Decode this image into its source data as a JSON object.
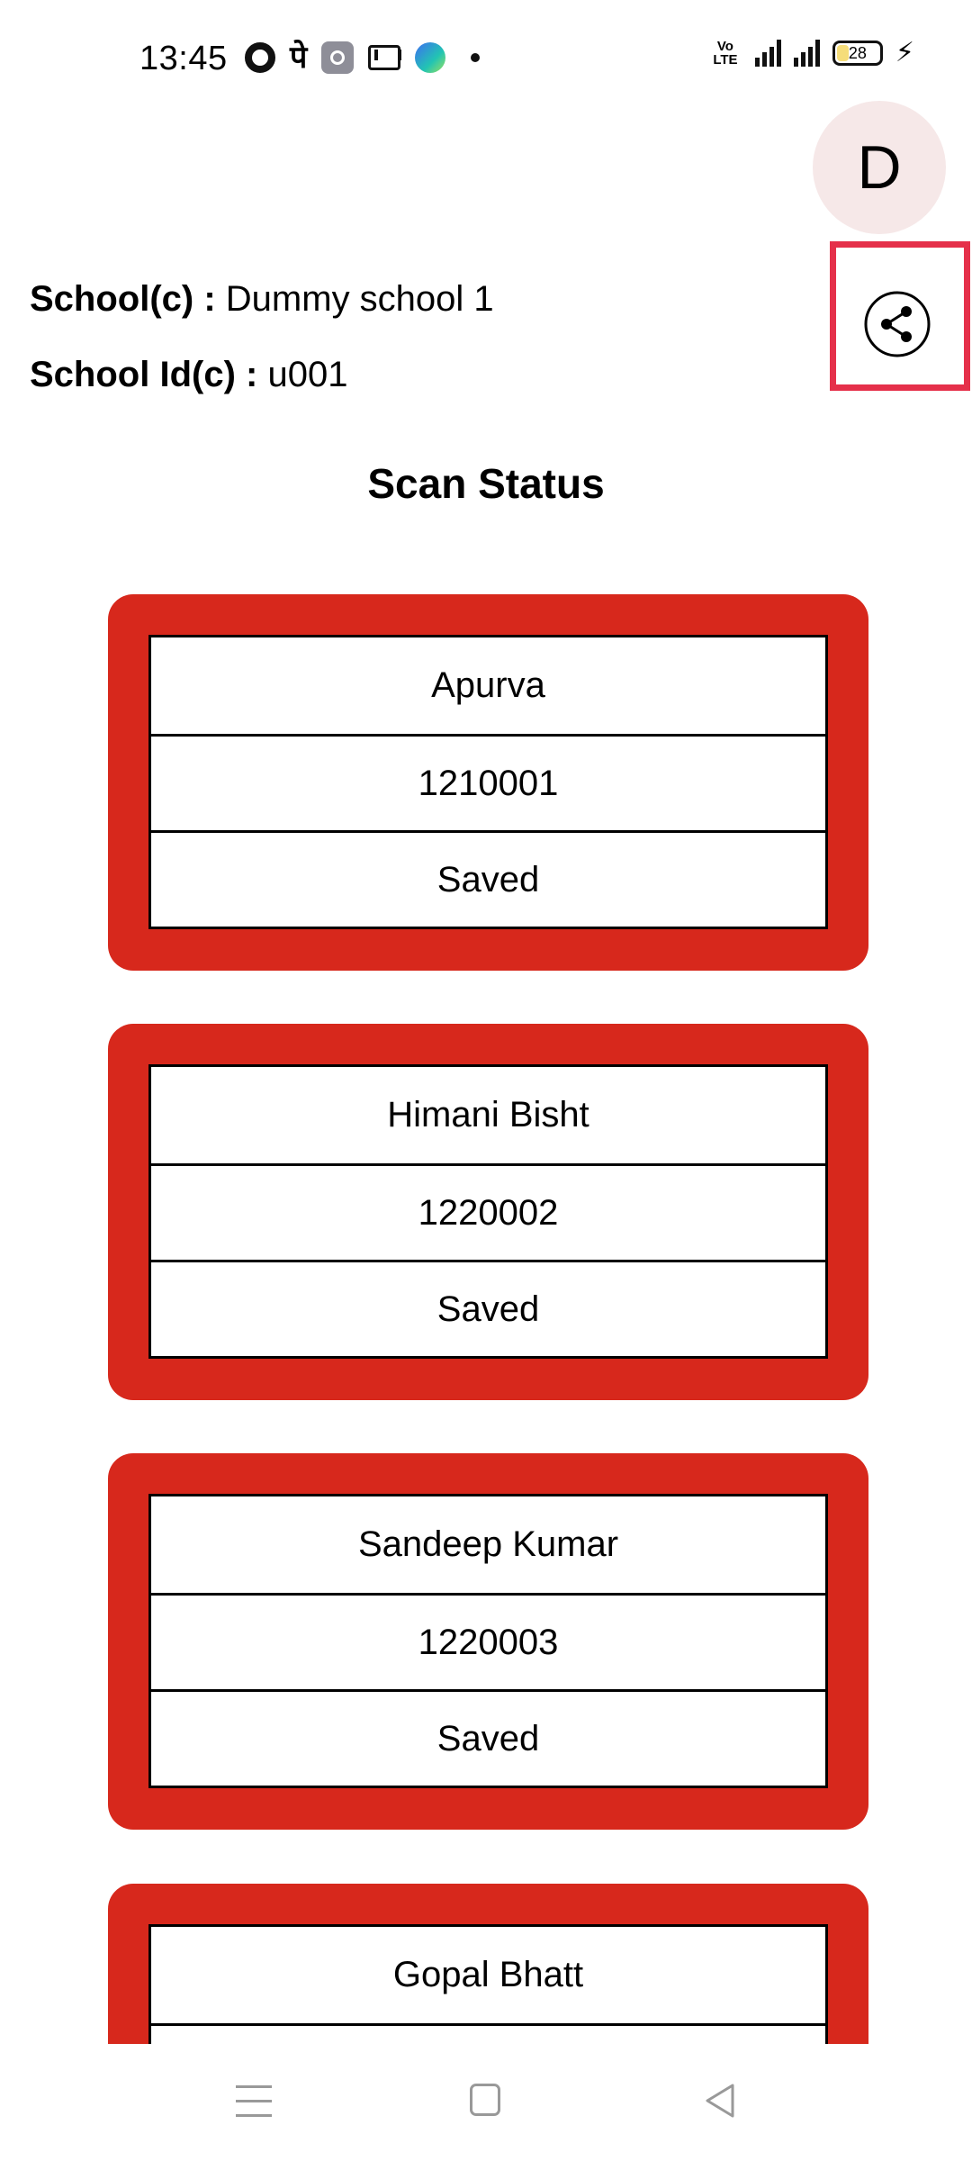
{
  "status_bar": {
    "time": "13:45",
    "left_icons": [
      "ring-icon",
      "phonepe-icon",
      "settings-app-icon",
      "mail-icon",
      "app-ball-icon",
      "notification-dot-icon"
    ],
    "volte": "VoLTE",
    "network": "4G",
    "battery": "28"
  },
  "avatar": {
    "initial": "D"
  },
  "school": {
    "name_label": "School(c) :",
    "name_value": "Dummy school 1",
    "id_label": "School Id(c) :",
    "id_value": "u001"
  },
  "page": {
    "title": "Scan Status"
  },
  "records": [
    {
      "name": "Apurva",
      "id": "1210001",
      "status": "Saved"
    },
    {
      "name": "Himani Bisht",
      "id": "1220002",
      "status": "Saved"
    },
    {
      "name": "Sandeep Kumar",
      "id": "1220003",
      "status": "Saved"
    },
    {
      "name": "Gopal Bhatt"
    }
  ],
  "colors": {
    "card_border": "#d7281c",
    "highlight_frame": "#e5304a",
    "avatar_bg": "#f6e8e8"
  },
  "nav_bar": {
    "icons": [
      "menu-icon",
      "home-icon",
      "back-icon"
    ]
  }
}
